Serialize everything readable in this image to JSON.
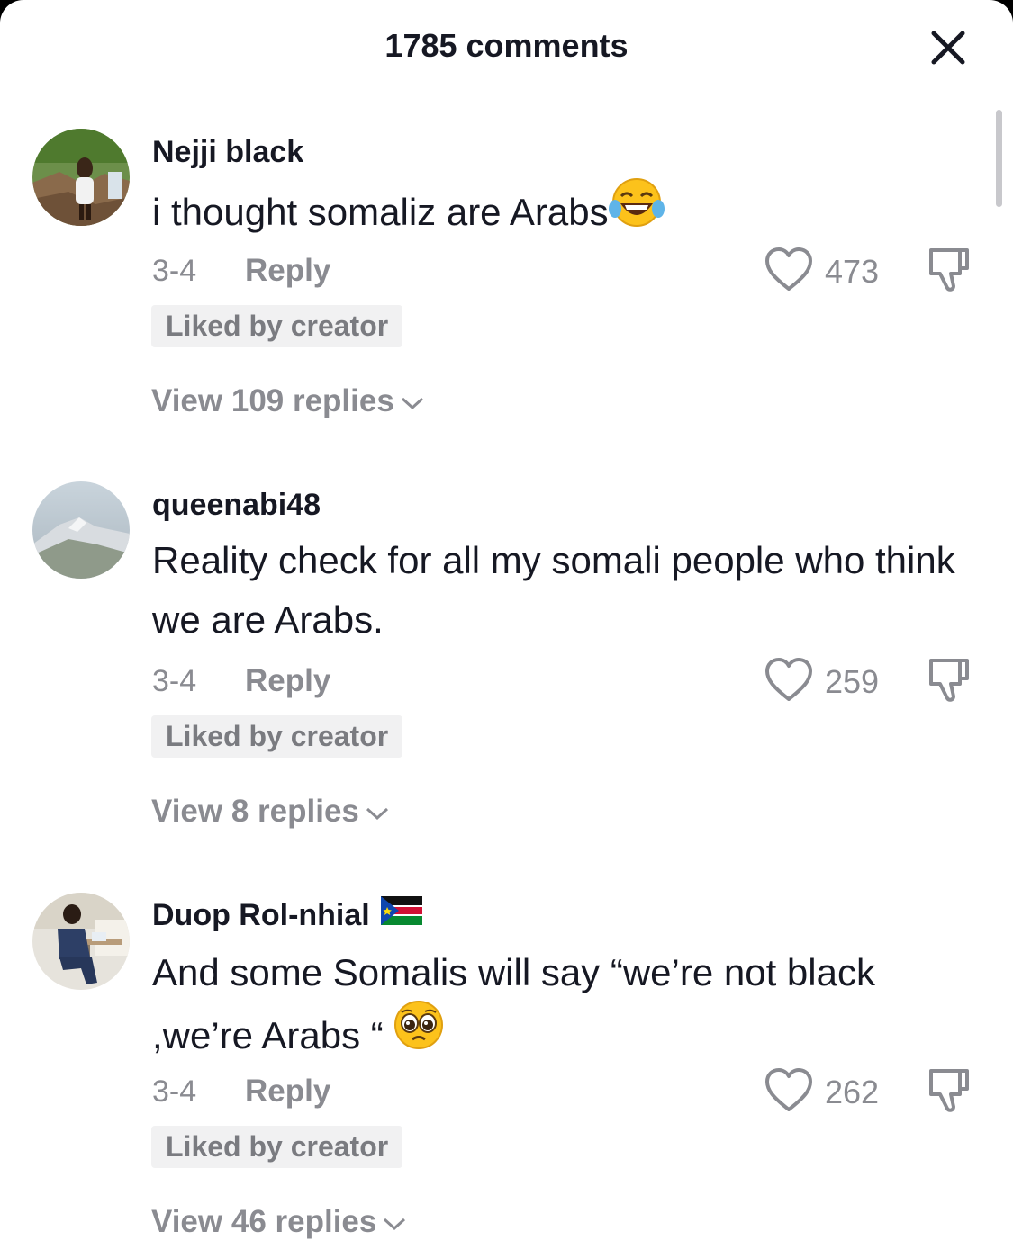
{
  "header": {
    "title": "1785 comments",
    "close_icon": "close-icon"
  },
  "comments": [
    {
      "username": "Nejji black",
      "text": "i thought somaliz are Arabs",
      "emoji": "😂",
      "date": "3-4",
      "reply_label": "Reply",
      "likes": "473",
      "badge": "Liked by creator",
      "view_replies": "View 109 replies"
    },
    {
      "username": "queenabi48",
      "text": "Reality check for all my somali people who think we are Arabs.",
      "date": "3-4",
      "reply_label": "Reply",
      "likes": "259",
      "badge": "Liked by creator",
      "view_replies": "View 8 replies"
    },
    {
      "username": "Duop Rol-nhial",
      "flag": "🇸🇸",
      "text": "And some Somalis will say “we’re not black ,we’re Arabs “",
      "emoji": "🥺",
      "date": "3-4",
      "reply_label": "Reply",
      "likes": "262",
      "badge": "Liked by creator",
      "view_replies": "View 46 replies"
    }
  ],
  "icons": {
    "like": "heart-outline-icon",
    "dislike": "thumbs-down-icon",
    "expand": "chevron-down-icon"
  },
  "colors": {
    "text_primary": "#161823",
    "text_secondary": "#8a8b91",
    "badge_bg": "#f1f1f2"
  }
}
